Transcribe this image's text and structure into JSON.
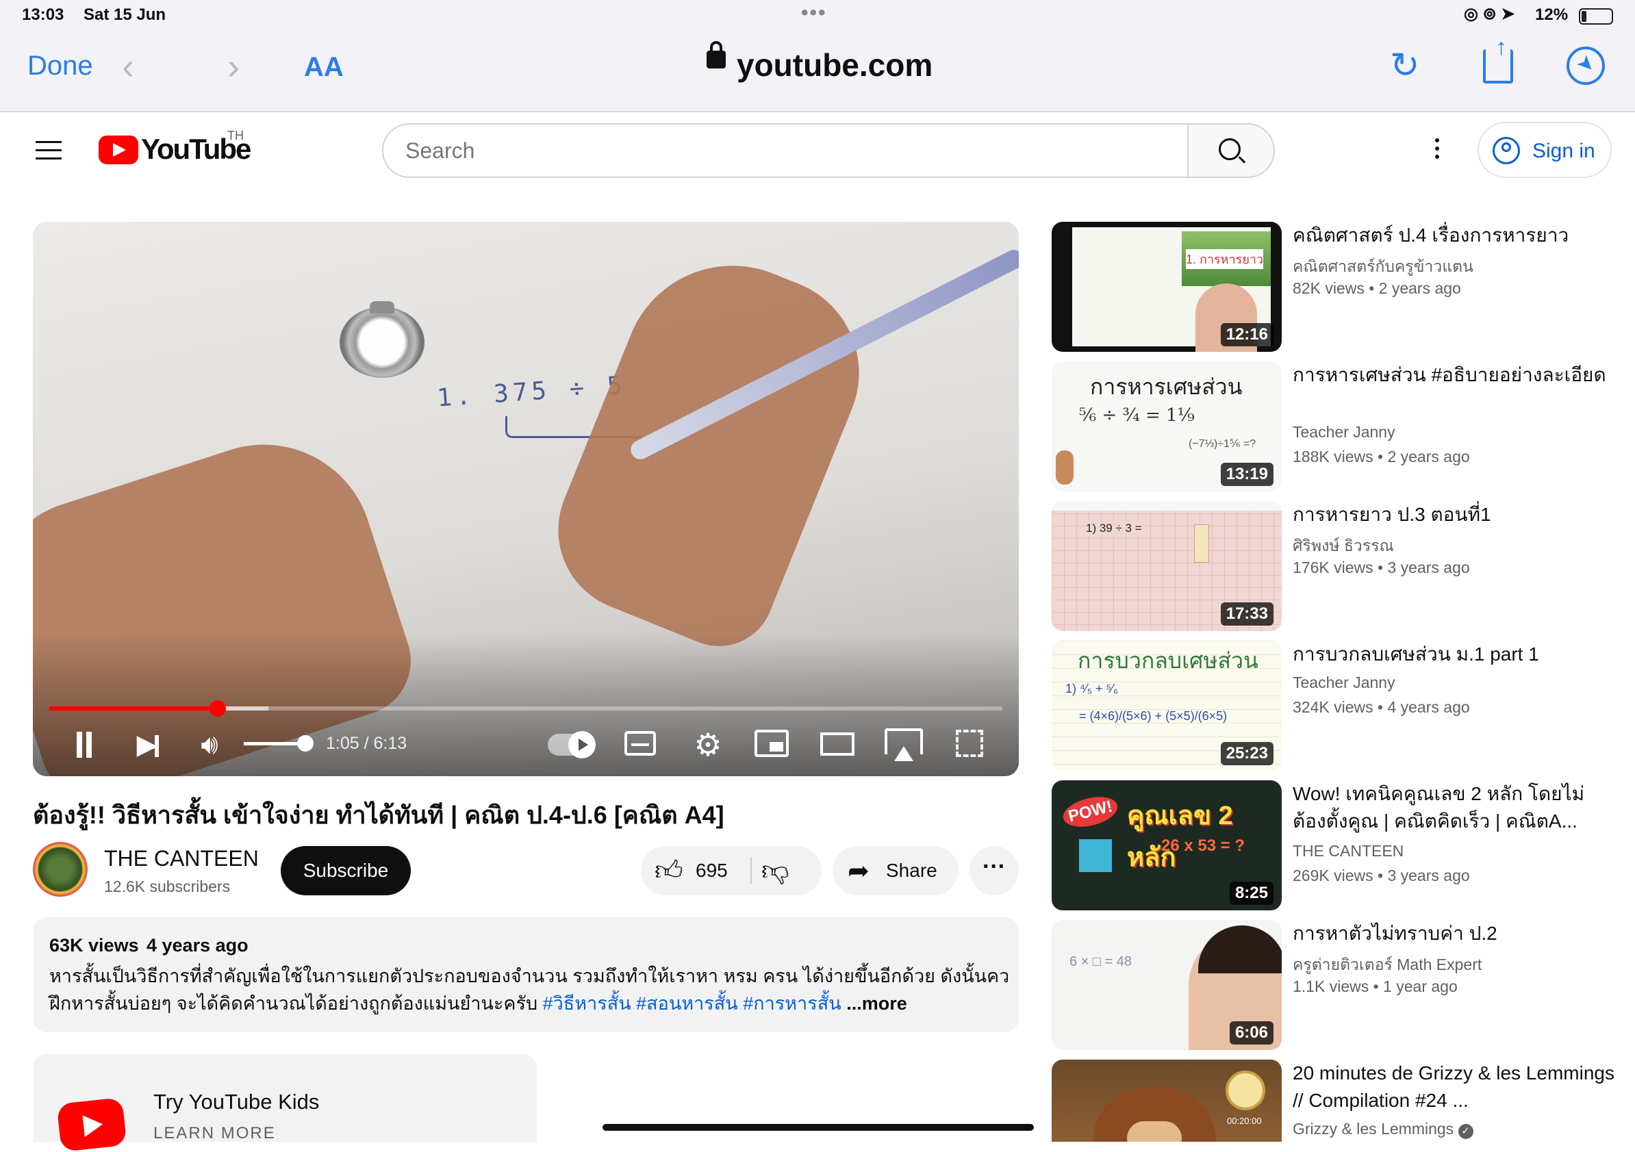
{
  "status": {
    "time": "13:03",
    "date": "Sat 15 Jun",
    "battery": "12%"
  },
  "safari": {
    "done": "Done",
    "text_size": "AA",
    "url": "youtube.com"
  },
  "yt": {
    "logo_text": "YouTube",
    "country": "TH",
    "search_placeholder": "Search",
    "sign_in": "Sign in"
  },
  "player": {
    "time": "1:05 / 6:13",
    "progress": 0.177,
    "volume": 0.9,
    "handwriting": "1.  375 ÷ 5"
  },
  "video": {
    "title": "ต้องรู้!! วิธีหารสั้น เข้าใจง่าย ทำได้ทันที | คณิต ป.4-ป.6 [คณิต A4]",
    "channel": "THE CANTEEN",
    "subscribers": "12.6K subscribers",
    "subscribe": "Subscribe",
    "likes": "695",
    "share": "Share",
    "views": "63K views",
    "age": "4 years ago",
    "desc_line1": "หารสั้นเป็นวิธีการที่สำคัญเพื่อใช้ในการแยกตัวประกอบของจำนวน รวมถึงทำให้เราหา หรม ครน ได้ง่ายขึ้นอีกด้วย ดังนั้นควร",
    "desc_line2": "ฝึกหารสั้นบ่อยๆ จะได้คิดคำนวณได้อย่างถูกต้องแม่นยำนะครับ",
    "hashtags": "#วิธีหารสั้น #สอนหารสั้น #การหารสั้น",
    "more": "...more"
  },
  "kids": {
    "title": "Try YouTube Kids",
    "learn": "LEARN MORE"
  },
  "sidebar": [
    {
      "title": "คณิตศาสตร์ ป.4 เรื่องการหารยาว",
      "channel": "คณิตศาสตร์กับครูข้าวแตน",
      "views": "82K views",
      "age": "• 2 years ago",
      "duration": "12:16",
      "thumb_text": "1. การหารยาว"
    },
    {
      "title": "การหารเศษส่วน #อธิบายอย่างละเอียด",
      "channel": "Teacher Janny",
      "views": "188K views",
      "age": "• 2 years ago",
      "duration": "13:19",
      "thumb_text": "การหารเศษส่วน"
    },
    {
      "title": "การหารยาว ป.3 ตอนที่1",
      "channel": "ศิริพงษ์ ธิวรรณ",
      "views": "176K views",
      "age": "• 3 years ago",
      "duration": "17:33",
      "thumb_text": "1) 39 ÷ 3 ="
    },
    {
      "title": "การบวกลบเศษส่วน ม.1 part 1",
      "channel": "Teacher Janny",
      "views": "324K views",
      "age": "• 4 years ago",
      "duration": "25:23",
      "thumb_text": "การบวกลบเศษส่วน"
    },
    {
      "title": "Wow! เทคนิคคูณเลข 2 หลัก โดยไม่ต้องตั้งคูณ | คณิตคิดเร็ว | คณิตA...",
      "channel": "THE CANTEEN",
      "views": "269K views",
      "age": "• 3 years ago",
      "duration": "8:25",
      "thumb_text": "คูณเลข 2 หลัก"
    },
    {
      "title": "การหาตัวไม่ทราบค่า ป.2",
      "channel": "ครูต่ายติวเตอร์ Math Expert",
      "views": "1.1K views",
      "age": "• 1 year ago",
      "duration": "6:06",
      "thumb_text": "6 × □ = 48"
    },
    {
      "title": "20 minutes de Grizzy & les Lemmings // Compilation #24 ...",
      "channel": "Grizzy & les Lemmings",
      "views": "",
      "age": "",
      "duration": "",
      "thumb_text": "00:20:00"
    }
  ]
}
